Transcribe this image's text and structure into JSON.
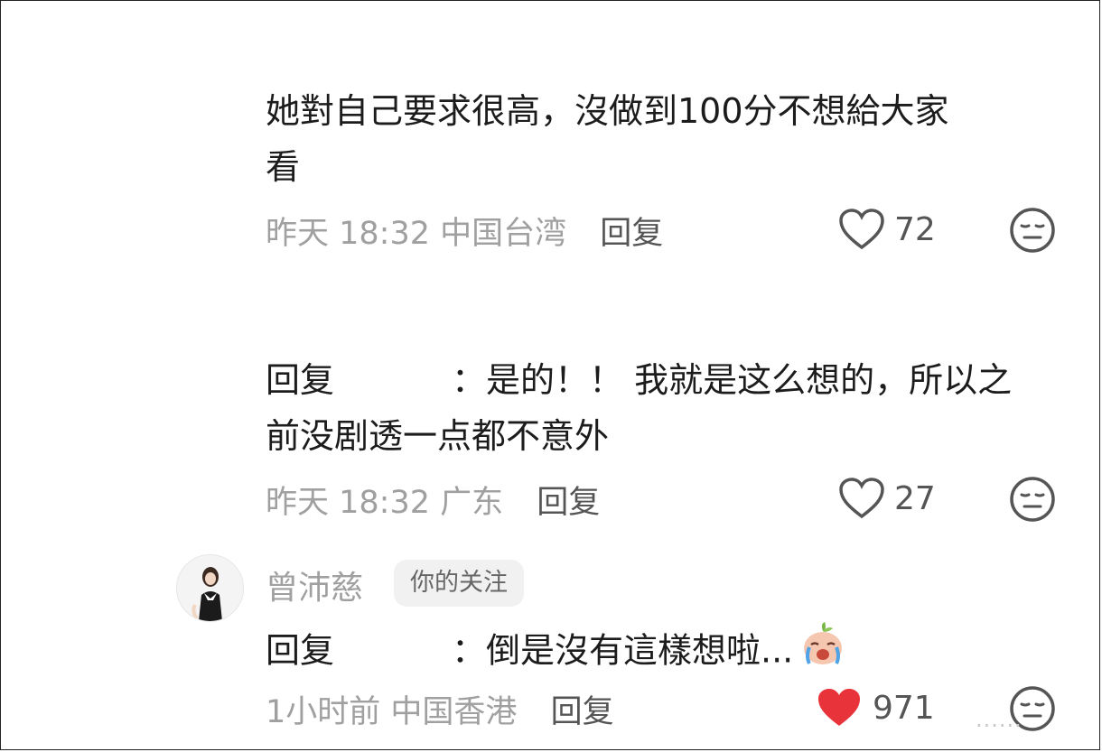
{
  "comments": [
    {
      "text_line1": "她對自己要求很高，沒做到100分不想給大家",
      "text_line2": "看",
      "time": "昨天 18:32",
      "location": "中国台湾",
      "reply_label": "回复",
      "likes": "72",
      "liked": false
    },
    {
      "reply_prefix": "回复",
      "text_line1": "：是的！！ 我就是这么想的，所以之",
      "text_line2": "前没剧透一点都不意外",
      "time": "昨天 18:32",
      "location": "广东",
      "reply_label": "回复",
      "likes": "27",
      "liked": false
    },
    {
      "author": "曾沛慈",
      "badge": "你的关注",
      "reply_prefix": "回复",
      "text_line1": "：倒是沒有這樣想啦...",
      "time": "1小时前",
      "location": "中国香港",
      "reply_label": "回复",
      "likes": "971",
      "liked": true
    }
  ],
  "colors": {
    "like_active": "#e8333a",
    "meta_gray": "#a0a0a0",
    "text": "#1c1c1c"
  },
  "icons": [
    "heart-outline-icon",
    "heart-filled-icon",
    "dislike-face-icon",
    "crying-emoji-icon",
    "avatar"
  ],
  "watermark": "······"
}
